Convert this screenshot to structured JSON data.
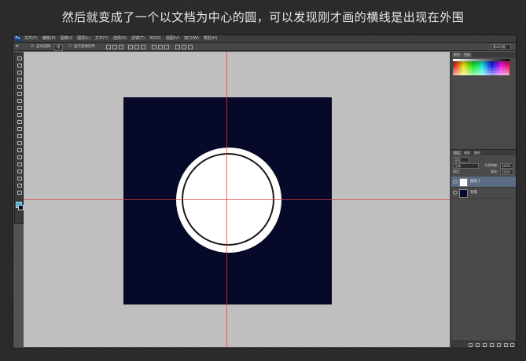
{
  "caption": "然后就变成了一个以文档为中心的圆，可以发现刚才画的横线是出现在外围",
  "app": {
    "logo": "Ps",
    "menus": [
      "文件(F)",
      "编辑(E)",
      "图像(I)",
      "图层(L)",
      "文字(Y)",
      "选择(S)",
      "滤镜(T)",
      "3D(D)",
      "视图(V)",
      "窗口(W)",
      "帮助(H)"
    ]
  },
  "options_bar": {
    "auto_select_label": "自动选择:",
    "auto_select_value": "组",
    "transform_label": "显示变换控件",
    "workspace": "基本功能"
  },
  "colors": {
    "document_bg": "#060a28",
    "canvas_bg": "#bfbfbf",
    "guide": "#e03c3c",
    "foreground": "#2bb6e8",
    "background": "#0a0a2a"
  },
  "swatches_panel": {
    "tabs": [
      "颜色",
      "色板"
    ]
  },
  "layers_panel": {
    "tabs": [
      "图层",
      "通道",
      "路径"
    ],
    "filter_label": "类型",
    "blend_mode": "正常",
    "opacity_label": "不透明度:",
    "opacity_value": "100%",
    "lock_label": "锁定:",
    "fill_label": "填充:",
    "fill_value": "100%",
    "layers": [
      {
        "name": "图层 1",
        "selected": true,
        "thumb_color": "#ffffff"
      },
      {
        "name": "背景",
        "selected": false,
        "thumb_color": "#060a28"
      }
    ]
  }
}
